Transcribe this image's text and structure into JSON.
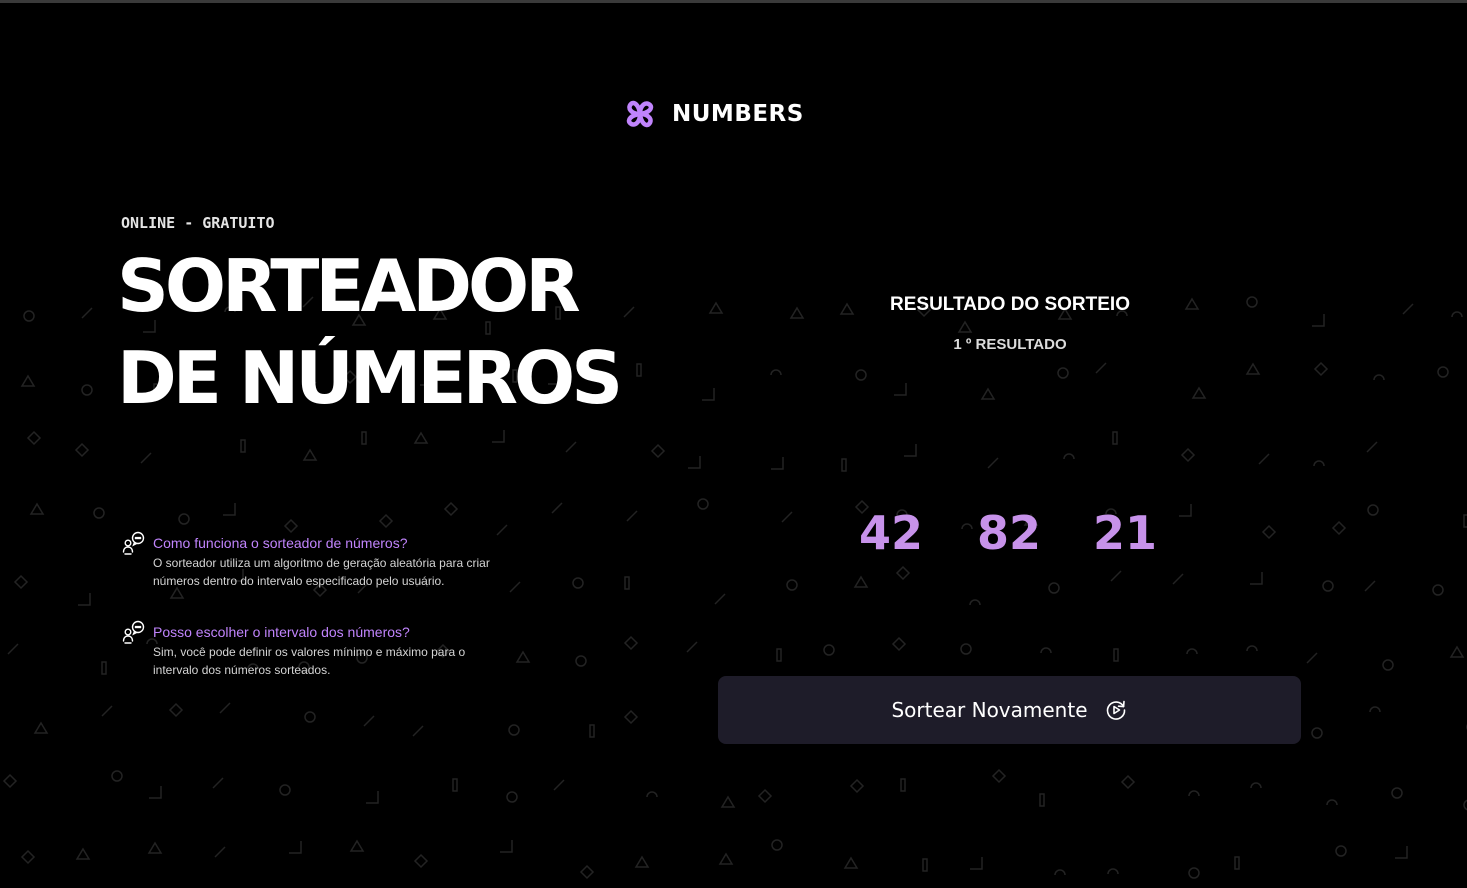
{
  "brand": {
    "name": "NUMBERS",
    "accent_color": "#c084fc",
    "icon": "logo-icon"
  },
  "hero": {
    "tagline": "ONLINE - GRATUITO",
    "title_line1": "SORTEADOR",
    "title_line2": "DE NÚMEROS"
  },
  "faq": [
    {
      "icon": "chat-users-icon",
      "question": "Como funciona o sorteador de números?",
      "answer": "O sorteador utiliza um algoritmo de geração aleatória para criar números dentro do intervalo especificado pelo usuário."
    },
    {
      "icon": "chat-users-icon",
      "question": "Posso escolher o intervalo dos números?",
      "answer": "Sim, você pode definir os valores mínimo e máximo para o intervalo dos números sorteados."
    }
  ],
  "result": {
    "title": "RESULTADO DO SORTEIO",
    "subtitle": "1 º RESULTADO",
    "numbers": [
      "42",
      "82",
      "21"
    ],
    "number_color": "#c792ea"
  },
  "actions": {
    "redraw_label": "Sortear Novamente",
    "redraw_icon": "refresh-icon"
  },
  "colors": {
    "background": "#000000",
    "button_bg": "#1e1c29",
    "pattern": "#232323"
  }
}
